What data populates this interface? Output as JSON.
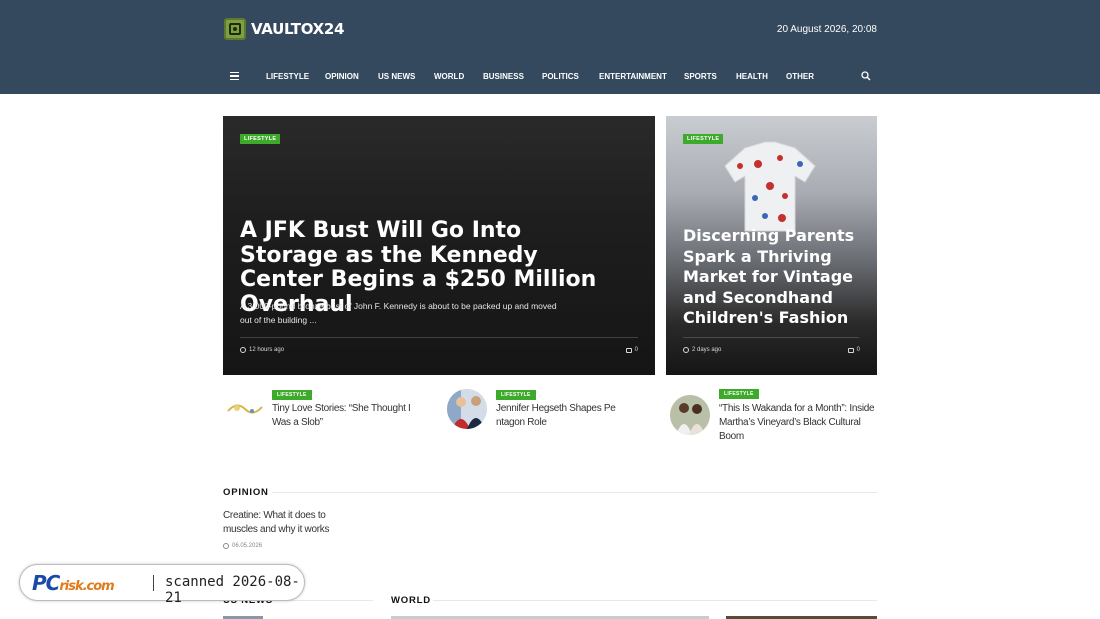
{
  "header": {
    "logo_text": "VAULTOX24",
    "datetime": "20 August 2026, 20:08",
    "bg_color": "#34495e"
  },
  "nav": {
    "menu_icon": "hamburger-icon",
    "items": [
      "LIFESTYLE",
      "OPINION",
      "US NEWS",
      "WORLD",
      "BUSINESS",
      "POLITICS",
      "ENTERTAINMENT",
      "SPORTS",
      "HEALTH",
      "OTHER"
    ],
    "search_icon": "search-icon"
  },
  "featured": {
    "main": {
      "badge": "LIFESTYLE",
      "title": "A JFK Bust Will Go Into Storage as the Kennedy Center Begins a $250 Million Overhaul",
      "excerpt": "A 3,000-pound bronze bust of John F. Kennedy is about to be packed up and moved out of the building ...",
      "time": "12 hours ago",
      "comments": "0"
    },
    "side": {
      "badge": "LIFESTYLE",
      "title": "Discerning Parents Spark a Thriving Market for Vintage and Secondhand Children's Fashion",
      "time": "2 days ago",
      "comments": "0"
    }
  },
  "mini_posts": [
    {
      "badge": "LIFESTYLE",
      "title": "Tiny Love Stories: “She Thought I Was a Slob”"
    },
    {
      "badge": "LIFESTYLE",
      "title": "Jennifer Hegseth Shapes Pe ntagon Role"
    },
    {
      "badge": "LIFESTYLE",
      "title": "“This Is Wakanda for a Month”: Inside Martha’s Vineyard’s Black Cultural Boom"
    }
  ],
  "opinion": {
    "label": "OPINION",
    "post_title": "Creatine: What it does to muscles and why it works",
    "post_date": "06.05.2026"
  },
  "sections": {
    "us_news": "US NEWS",
    "world": "WORLD"
  },
  "watermark": {
    "logo_pc": "PC",
    "logo_risk": "risk.com",
    "text": "scanned 2026-08-21"
  },
  "colors": {
    "accent_green": "#3daa2b"
  }
}
